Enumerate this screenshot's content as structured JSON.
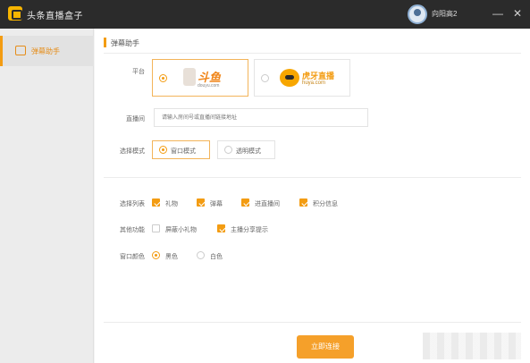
{
  "window": {
    "title": "头条直播盒子",
    "user_name": "向阳高2",
    "minimize_icon": "—",
    "close_icon": "✕"
  },
  "sidebar": {
    "items": [
      {
        "label": "弹幕助手",
        "icon": "danmaku-icon",
        "active": true
      }
    ]
  },
  "main": {
    "section_title": "弹幕助手",
    "platform": {
      "label": "平台",
      "options": [
        {
          "name": "斗鱼",
          "url": "douyu.com",
          "selected": true
        },
        {
          "name": "虎牙直播",
          "url": "huya.com",
          "selected": false
        }
      ]
    },
    "room": {
      "label": "直播间",
      "placeholder": "请输入房间号或直播间链接地址"
    },
    "mode": {
      "label": "选择模式",
      "options": [
        {
          "label": "窗口模式",
          "selected": true
        },
        {
          "label": "透明模式",
          "selected": false
        }
      ]
    },
    "list": {
      "label": "选择列表",
      "options": [
        {
          "label": "礼物",
          "checked": true
        },
        {
          "label": "弹幕",
          "checked": true
        },
        {
          "label": "进直播间",
          "checked": true
        },
        {
          "label": "积分信息",
          "checked": true
        }
      ]
    },
    "other": {
      "label": "其他功能",
      "options": [
        {
          "label": "屏蔽小礼物",
          "checked": false
        },
        {
          "label": "主播分享提示",
          "checked": true
        }
      ]
    },
    "color": {
      "label": "窗口颜色",
      "options": [
        {
          "label": "黑色",
          "selected": true
        },
        {
          "label": "白色",
          "selected": false
        }
      ]
    },
    "confirm_label": "立即连接"
  },
  "colors": {
    "accent": "#f39c12",
    "titlebar": "#2b2b2b"
  }
}
